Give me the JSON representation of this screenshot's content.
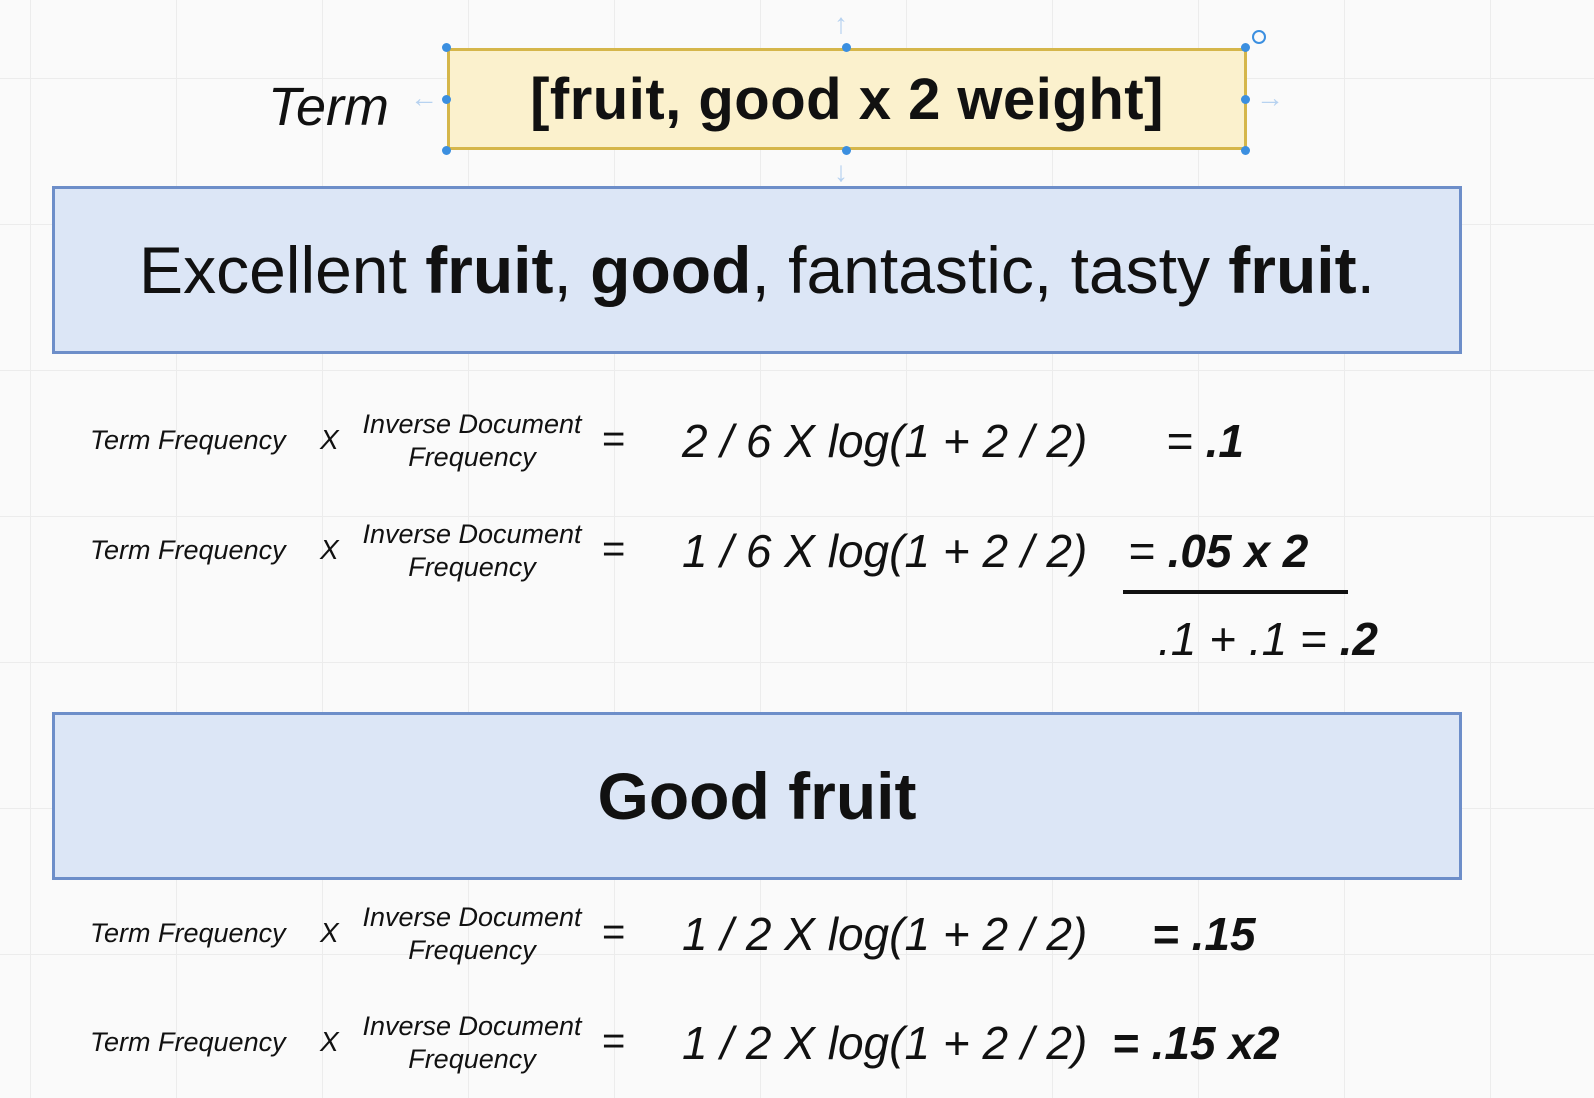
{
  "term": {
    "label": "Term",
    "box_text": "[fruit, good x 2 weight]"
  },
  "doc1": {
    "parts": [
      {
        "text": "Excellent ",
        "bold": false
      },
      {
        "text": "fruit",
        "bold": true
      },
      {
        "text": ", ",
        "bold": false
      },
      {
        "text": "good",
        "bold": true
      },
      {
        "text": ", fantastic, tasty ",
        "bold": false
      },
      {
        "text": "fruit",
        "bold": true
      },
      {
        "text": ".",
        "bold": false
      }
    ]
  },
  "doc2": {
    "text": "Good fruit"
  },
  "labels": {
    "term_frequency": "Term Frequency",
    "times": "X",
    "idf_line1": "Inverse Document",
    "idf_line2": "Frequency",
    "equals": "="
  },
  "rows": [
    {
      "expr": "2 / 6 X log(1 + 2 / 2)",
      "result_pre": "= ",
      "result_bold": ".1"
    },
    {
      "expr": "1 / 6 X log(1 + 2 / 2)",
      "result_pre": "= ",
      "result_bold": ".05 x 2"
    },
    {
      "expr": "1 / 2 X log(1 + 2 / 2)",
      "result_pre": "",
      "result_bold": "= .15"
    },
    {
      "expr": "1 / 2 X log(1 + 2 / 2)",
      "result_pre": "",
      "result_bold": "= .15 x2"
    }
  ],
  "sum": {
    "pre": ".1 + .1 = ",
    "bold": ".2"
  }
}
